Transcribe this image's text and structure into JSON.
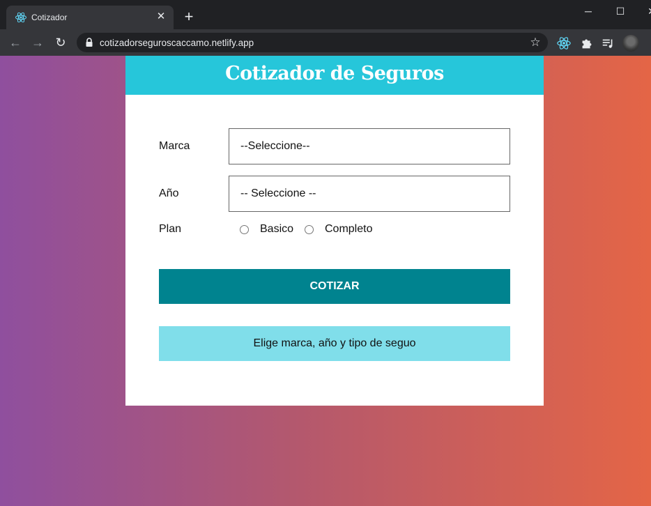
{
  "browser": {
    "tab_title": "Cotizador",
    "tab_close": "✕",
    "new_tab": "+",
    "url": "cotizadorseguroscaccamo.netlify.app",
    "window_controls": {
      "minimize": "─",
      "maximize": "☐",
      "close": "✕"
    }
  },
  "header": {
    "title": "Cotizador de Seguros"
  },
  "form": {
    "marca": {
      "label": "Marca",
      "value": "--Seleccione--"
    },
    "anio": {
      "label": "Año",
      "value": "-- Seleccione --"
    },
    "plan": {
      "label": "Plan",
      "options": [
        {
          "label": "Basico",
          "checked": false
        },
        {
          "label": "Completo",
          "checked": false
        }
      ]
    },
    "submit_label": "COTIZAR"
  },
  "message": "Elige marca, año y tipo de seguo",
  "colors": {
    "header": "#26c6da",
    "button": "#00838f",
    "message": "#80deea",
    "gradient_left": "#8f4f9e",
    "gradient_right": "#e46546"
  },
  "icons": [
    "react-icon",
    "lock-icon",
    "star-icon",
    "extension-icon",
    "puzzle-icon",
    "media-icon"
  ]
}
